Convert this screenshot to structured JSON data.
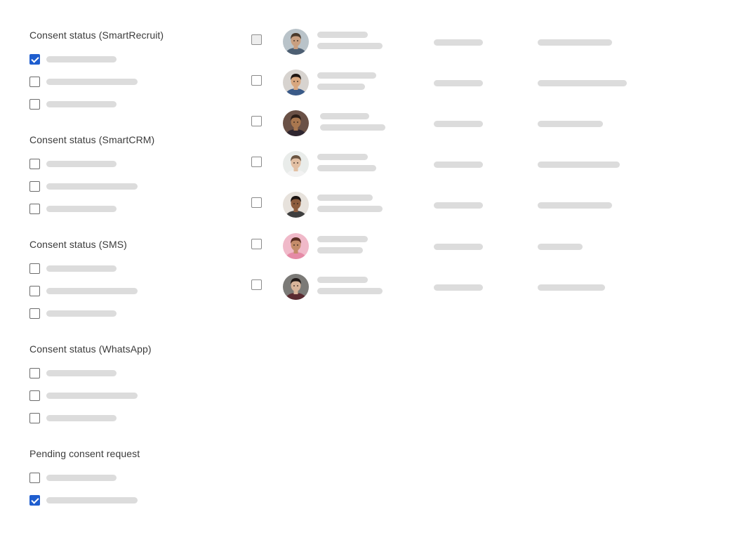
{
  "filter_groups": [
    {
      "title": "Consent status (SmartRecruit)",
      "options": [
        {
          "checked": true,
          "placeholder_width": 100
        },
        {
          "checked": false,
          "placeholder_width": 130
        },
        {
          "checked": false,
          "placeholder_width": 100
        }
      ]
    },
    {
      "title": "Consent status (SmartCRM)",
      "options": [
        {
          "checked": false,
          "placeholder_width": 100
        },
        {
          "checked": false,
          "placeholder_width": 130
        },
        {
          "checked": false,
          "placeholder_width": 100
        }
      ]
    },
    {
      "title": "Consent status (SMS)",
      "options": [
        {
          "checked": false,
          "placeholder_width": 100
        },
        {
          "checked": false,
          "placeholder_width": 130
        },
        {
          "checked": false,
          "placeholder_width": 100
        }
      ]
    },
    {
      "title": "Consent status (WhatsApp)",
      "options": [
        {
          "checked": false,
          "placeholder_width": 100
        },
        {
          "checked": false,
          "placeholder_width": 130
        },
        {
          "checked": false,
          "placeholder_width": 100
        }
      ]
    },
    {
      "title": "Pending consent request",
      "options": [
        {
          "checked": false,
          "placeholder_width": 100
        },
        {
          "checked": true,
          "placeholder_width": 130
        }
      ]
    }
  ],
  "candidates": [
    {
      "avatar": {
        "skin": "#c99f80",
        "hair": "#4a3a2c",
        "bg": "#b9c3c9",
        "shirt": "#4d5f73"
      }
    },
    {
      "avatar": {
        "skin": "#d9a77f",
        "hair": "#1f1612",
        "bg": "#d7d3cf",
        "shirt": "#3a5a88"
      }
    },
    {
      "avatar": {
        "skin": "#a9774f",
        "hair": "#2a1d16",
        "bg": "#6a5146",
        "shirt": "#2f2630"
      }
    },
    {
      "avatar": {
        "skin": "#e2bfa3",
        "hair": "#6a5441",
        "bg": "#e9ecea",
        "shirt": "#f2f2f2"
      }
    },
    {
      "avatar": {
        "skin": "#8d5d3e",
        "hair": "#1b1311",
        "bg": "#e7e2dc",
        "shirt": "#3f3f3f"
      }
    },
    {
      "avatar": {
        "skin": "#c48c6a",
        "hair": "#5a2d22",
        "bg": "#f0b9c9",
        "shirt": "#e58aa6"
      }
    },
    {
      "avatar": {
        "skin": "#d8b49a",
        "hair": "#201816",
        "bg": "#7b7a77",
        "shirt": "#5a2a31"
      }
    }
  ]
}
